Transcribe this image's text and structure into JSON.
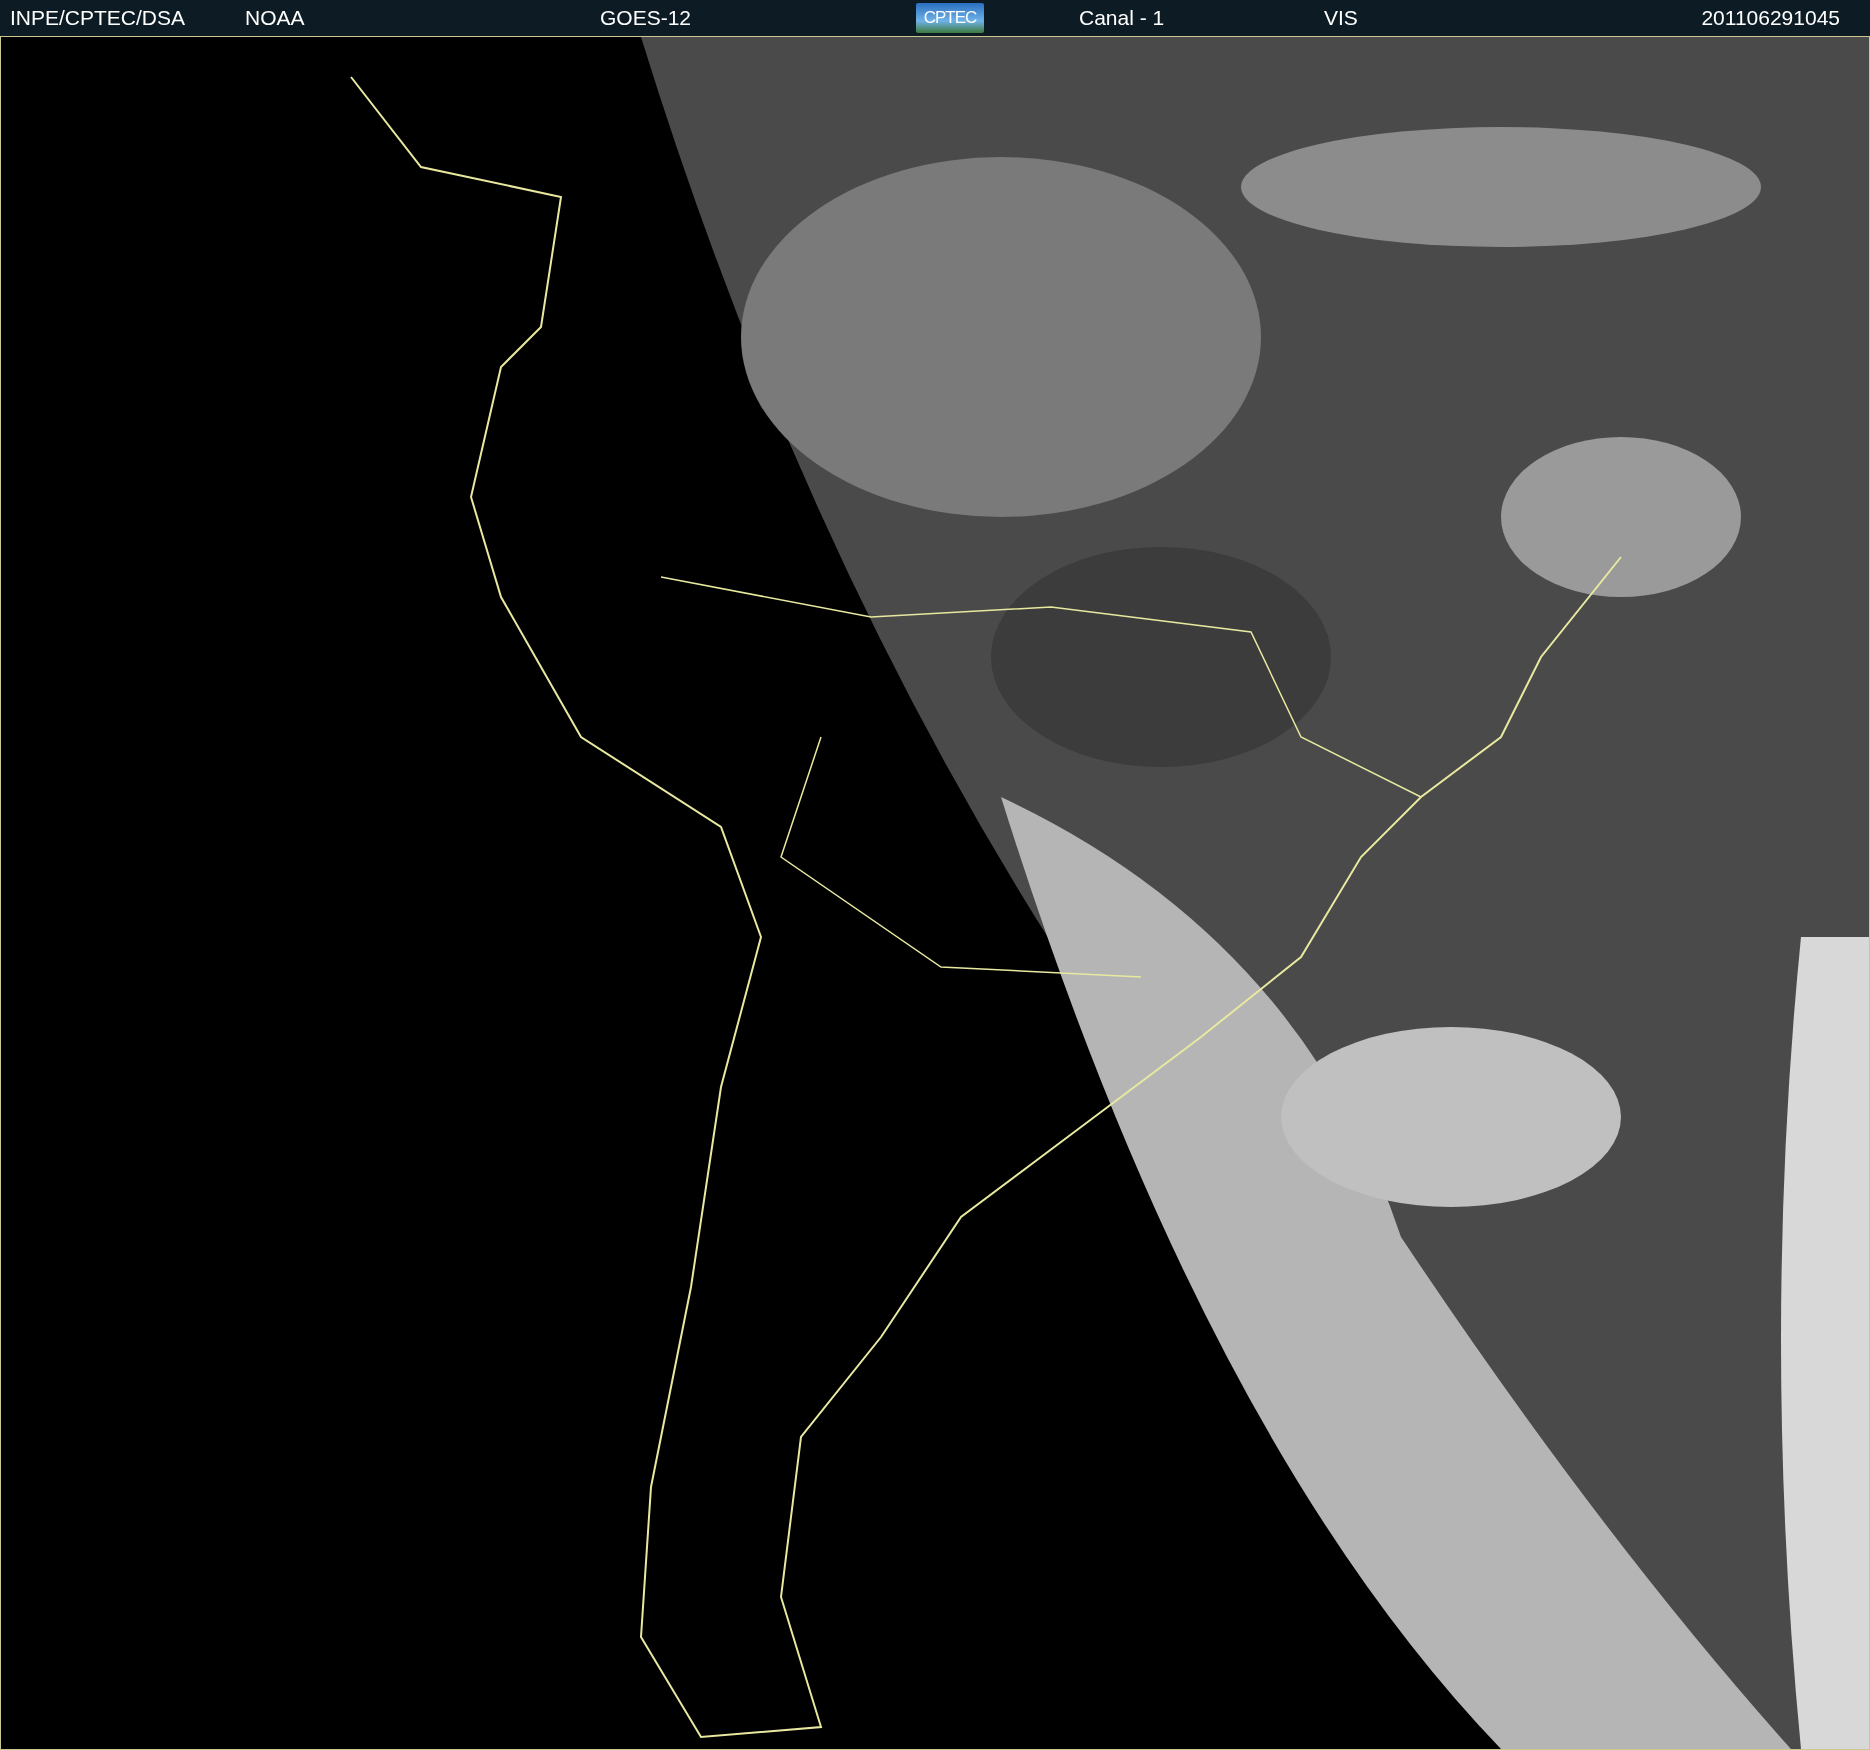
{
  "header": {
    "items": [
      {
        "kind": "text",
        "text": "INPE/CPTEC/DSA"
      },
      {
        "kind": "text",
        "text": "NOAA"
      },
      {
        "kind": "text",
        "text": "GOES-12"
      },
      {
        "kind": "logo",
        "text": "CPTEC"
      },
      {
        "kind": "text",
        "text": "Canal - 1"
      },
      {
        "kind": "text",
        "text": "VIS"
      },
      {
        "kind": "text",
        "text": "201106291045"
      }
    ]
  }
}
